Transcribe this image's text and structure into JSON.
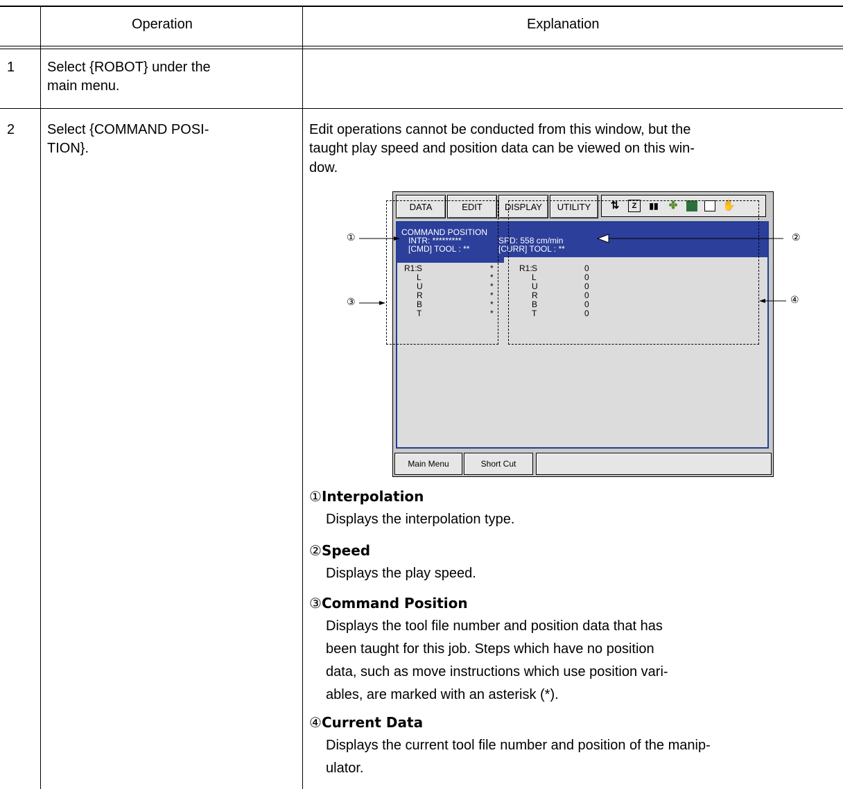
{
  "table": {
    "header": {
      "operation": "Operation",
      "explanation": "Explanation"
    },
    "rows": [
      {
        "num": "1",
        "operation": [
          "Select {ROBOT} under the",
          "main menu."
        ]
      },
      {
        "num": "2",
        "operation": [
          "Select {COMMAND POSI-",
          "TION}."
        ],
        "explanation": [
          "Edit operations cannot be conducted from this window, but the",
          "taught play speed and position data can be viewed on this win-",
          "dow."
        ]
      }
    ]
  },
  "screen": {
    "menu": [
      "DATA",
      "EDIT",
      "DISPLAY",
      "UTILITY"
    ],
    "icons": [
      "status-icon-1",
      "status-icon-2",
      "status-icon-3",
      "status-icon-4",
      "status-icon-5",
      "status-icon-6",
      "hand-icon"
    ],
    "window_title": "COMMAND POSITION",
    "intr": "INTR: *********",
    "spd": "SPD:  558 cm/min",
    "cmd": "[CMD]  TOOL : **",
    "curr": "[CURR]  TOOL : **",
    "prefix": "R1:",
    "axes": [
      "S",
      "L",
      "U",
      "R",
      "B",
      "T"
    ],
    "cmd_values": [
      "*",
      "*",
      "*",
      "*",
      "*",
      "*"
    ],
    "curr_values": [
      "0",
      "0",
      "0",
      "0",
      "0",
      "0"
    ],
    "footer": [
      "Main Menu",
      "Short Cut"
    ],
    "callouts": [
      "①",
      "②",
      "③",
      "④"
    ]
  },
  "items": [
    {
      "num": "①",
      "title": "Interpolation",
      "desc": [
        "Displays the interpolation type."
      ]
    },
    {
      "num": "②",
      "title": "Speed",
      "desc": [
        "Displays the play speed."
      ]
    },
    {
      "num": "③",
      "title": "Command Position",
      "desc": [
        "Displays the tool file number and position data that has",
        "been taught for this job.  Steps which have no position",
        "data, such as move instructions which use position vari-",
        "ables, are marked with an asterisk (*)."
      ]
    },
    {
      "num": "④",
      "title": "Current Data",
      "desc": [
        "Displays the current tool file number and position of the manip-",
        "ulator."
      ]
    }
  ]
}
